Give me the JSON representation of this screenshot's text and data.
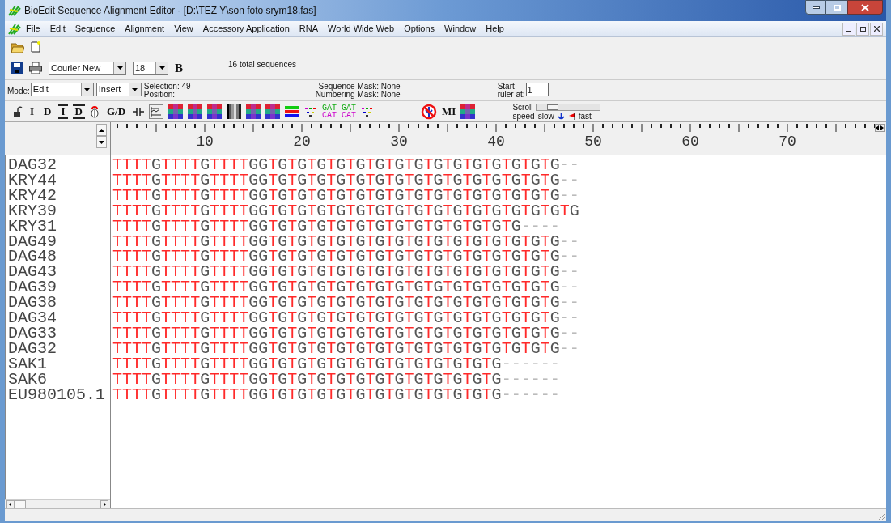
{
  "window": {
    "title": "BioEdit Sequence Alignment Editor - [D:\\TEZ Y\\son foto srym18.fas]"
  },
  "menu": [
    "File",
    "Edit",
    "Sequence",
    "Alignment",
    "View",
    "Accessory Application",
    "RNA",
    "World Wide Web",
    "Options",
    "Window",
    "Help"
  ],
  "font_select": {
    "value": "Courier New"
  },
  "size_select": {
    "value": "18"
  },
  "bold_button": "B",
  "total_sequences": "16 total sequences",
  "mode": {
    "label": "Mode:",
    "value": "Edit"
  },
  "insert_select": {
    "value": "Insert"
  },
  "selection": "Selection: 49",
  "position": "Position:",
  "sequence_mask": "Sequence Mask: None",
  "numbering_mask": "Numbering Mask: None",
  "ruler_start": {
    "label_1": "Start",
    "label_2": "ruler at:",
    "value": "1"
  },
  "edit_tools": [
    {
      "kind": "lock"
    },
    {
      "kind": "text",
      "label": "I",
      "lined": false
    },
    {
      "kind": "text",
      "label": "D",
      "lined": false
    },
    {
      "kind": "text",
      "label": "I",
      "lined": true
    },
    {
      "kind": "text",
      "label": "D",
      "lined": true
    },
    {
      "kind": "bug"
    },
    {
      "kind": "text",
      "label": "G/D",
      "lined": false
    },
    {
      "kind": "split"
    },
    {
      "kind": "graph"
    },
    {
      "kind": "grid"
    },
    {
      "kind": "grid"
    },
    {
      "kind": "grid"
    },
    {
      "kind": "bars"
    },
    {
      "kind": "grid"
    },
    {
      "kind": "grid"
    },
    {
      "kind": "stripes"
    },
    {
      "kind": "dots"
    },
    {
      "kind": "gatcat",
      "top": "GAT",
      "bottom": "CAT"
    },
    {
      "kind": "gatcat",
      "top": "GAT",
      "bottom": "CAT"
    },
    {
      "kind": "dots"
    }
  ],
  "extra_tools": [
    {
      "kind": "nosign"
    },
    {
      "kind": "text",
      "label": "MI",
      "lined": false
    },
    {
      "kind": "grid"
    }
  ],
  "scroll_speed": {
    "label_1": "Scroll",
    "label_2": "speed",
    "slow": "slow",
    "fast": "fast",
    "level": 0.2
  },
  "ruler_labels": [
    "10",
    "20",
    "30",
    "40",
    "50",
    "60",
    "70"
  ],
  "sequences": [
    {
      "name": "DAG32",
      "residues": "TTTTGTTTTGTTTTGGTGTGTGTGTGTGTGTGTGTGTGTGTGTGTG--"
    },
    {
      "name": "KRY44",
      "residues": "TTTTGTTTTGTTTTGGTGTGTGTGTGTGTGTGTGTGTGTGTGTGTG--"
    },
    {
      "name": "KRY42",
      "residues": "TTTTGTTTTGTTTTGGTGTGTGTGTGTGTGTGTGTGTGTGTGTGTG--"
    },
    {
      "name": "KRY39",
      "residues": "TTTTGTTTTGTTTTGGTGTGTGTGTGTGTGTGTGTGTGTGTGTGTGTG"
    },
    {
      "name": "KRY31",
      "residues": "TTTTGTTTTGTTTTGGTGTGTGTGTGTGTGTGTGTGTGTGTG----"
    },
    {
      "name": "DAG49",
      "residues": "TTTTGTTTTGTTTTGGTGTGTGTGTGTGTGTGTGTGTGTGTGTGTG--"
    },
    {
      "name": "DAG48",
      "residues": "TTTTGTTTTGTTTTGGTGTGTGTGTGTGTGTGTGTGTGTGTGTGTG--"
    },
    {
      "name": "DAG43",
      "residues": "TTTTGTTTTGTTTTGGTGTGTGTGTGTGTGTGTGTGTGTGTGTGTG--"
    },
    {
      "name": "DAG39",
      "residues": "TTTTGTTTTGTTTTGGTGTGTGTGTGTGTGTGTGTGTGTGTGTGTG--"
    },
    {
      "name": "DAG38",
      "residues": "TTTTGTTTTGTTTTGGTGTGTGTGTGTGTGTGTGTGTGTGTGTGTG--"
    },
    {
      "name": "DAG34",
      "residues": "TTTTGTTTTGTTTTGGTGTGTGTGTGTGTGTGTGTGTGTGTGTGTG--"
    },
    {
      "name": "DAG33",
      "residues": "TTTTGTTTTGTTTTGGTGTGTGTGTGTGTGTGTGTGTGTGTGTGTG--"
    },
    {
      "name": "DAG32",
      "residues": "TTTTGTTTTGTTTTGGTGTGTGTGTGTGTGTGTGTGTGTGTGTGTG--"
    },
    {
      "name": "SAK1",
      "residues": "TTTTGTTTTGTTTTGGTGTGTGTGTGTGTGTGTGTGTGTG------"
    },
    {
      "name": "SAK6",
      "residues": "TTTTGTTTTGTTTTGGTGTGTGTGTGTGTGTGTGTGTGTG------"
    },
    {
      "name": "EU980105.1",
      "residues": "TTTTGTTTTGTTTTGGTGTGTGTGTGTGTGTGTGTGTGTG------"
    }
  ]
}
